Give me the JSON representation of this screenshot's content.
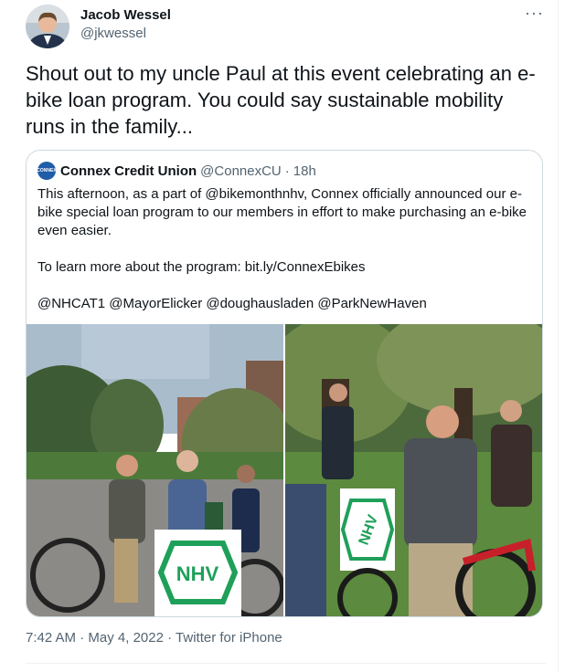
{
  "author": {
    "name": "Jacob Wessel",
    "handle": "@jkwessel"
  },
  "menu": {
    "more_glyph": "···"
  },
  "tweet": {
    "text": "Shout out to my uncle Paul at this event celebrating an e-bike loan program. You could say sustainable mobility runs in the family..."
  },
  "quote": {
    "avatar_label": "CONNEX",
    "name": "Connex Credit Union",
    "handle": "@ConnexCU",
    "separator": "·",
    "time": "18h",
    "para1": "This afternoon, as a part of @bikemonthnhv, Connex officially announced our e-bike special loan program to our members in effort to make purchasing an e-bike even easier.",
    "para2": "To learn more about the program: bit.ly/ConnexEbikes",
    "para3": "@NHCAT1 @MayorElicker @doughausladen @ParkNewHaven",
    "sign_text": "NHV"
  },
  "footer": {
    "time": "7:42 AM",
    "dot1": "·",
    "date": "May 4, 2022",
    "dot2": "·",
    "source": "Twitter for iPhone"
  },
  "colors": {
    "text": "#0f1419",
    "secondary": "#536471",
    "border": "#cfd9de",
    "sign_green": "#1fa05a",
    "sign_blue": "#2a6ed8"
  }
}
